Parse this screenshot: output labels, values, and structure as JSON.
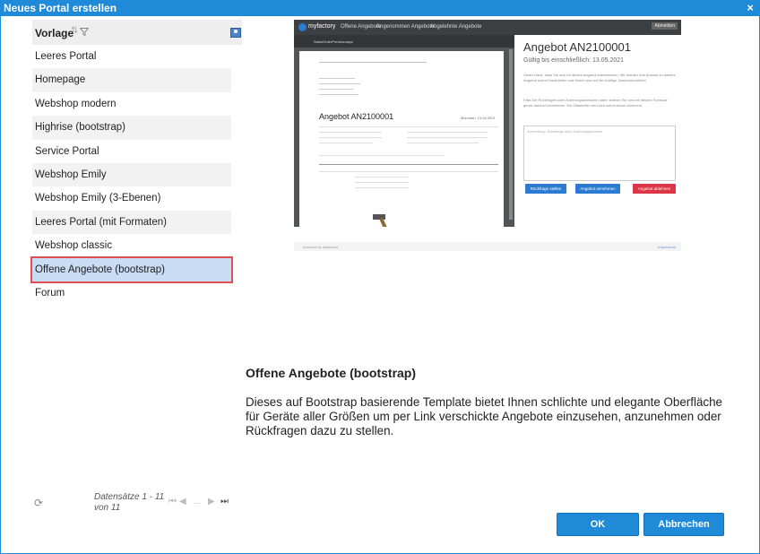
{
  "window": {
    "title": "Neues Portal erstellen",
    "close_glyph": "×"
  },
  "list": {
    "header_label": "Vorlage",
    "items": [
      "Leeres Portal",
      "Homepage",
      "Webshop modern",
      "Highrise (bootstrap)",
      "Service Portal",
      "Webshop Emily",
      "Webshop Emily (3-Ebenen)",
      "Leeres Portal (mit Formaten)",
      "Webshop classic",
      "Offene Angebote (bootstrap)",
      "Forum"
    ],
    "selected_index": 9
  },
  "pager": {
    "info_line1": "Datensätze 1 - 11",
    "info_line2": "von 11",
    "ellipsis": "..."
  },
  "preview": {
    "nav_brand": "myfactory",
    "nav_links": [
      "Offene Angebote",
      "Angenommen Angebote",
      "Abgelehnte Angebote"
    ],
    "nav_button": "Abmelden",
    "pdf_toolbar_file": "SalesOrderPreview.aspx",
    "pdf_heading": "Angebot AN2100001",
    "pdf_date": "München, 13.04.2021",
    "offer_title": "Angebot AN2100001",
    "valid_until": "Gültig bis einschließlich: 13.05.2021",
    "intro_text": "Vielen Dank, dass Sie sich für dieses Angebot interessieren. Wir werden Ihre Antwort zu diesem Angebot schnell bearbeiten und freuen uns auf die künftige Zusammenarbeit!",
    "info_text": "Falls Sie Rückfragen oder Änderungswünsche haben können Sie uns mit diesem Formular gerne darüber informieren. Ein Mitarbeiter wird sich sofort darum kümmern.",
    "textarea_placeholder": "Anmerkung, Rückfrage oder Änderungswunsch",
    "btn_question": "Rückfrage stellen",
    "btn_accept": "Angebot annehmen",
    "btn_decline": "Angebot ablehnen",
    "footer_left": "powered by  myfactory",
    "footer_right": "Impressum",
    "colors": {
      "nav": "#3d4043",
      "primary": "#2a7bd1",
      "danger": "#dc3545"
    }
  },
  "description": {
    "title": "Offene Angebote (bootstrap)",
    "text": "Dieses auf Bootstrap basierende Template bietet Ihnen schlichte und elegante Oberfläche für Geräte aller Größen um per Link verschickte Angebote einzusehen, anzunehmen oder Rückfragen dazu zu stellen."
  },
  "buttons": {
    "ok": "OK",
    "cancel": "Abbrechen"
  },
  "colors": {
    "accent": "#1e8ad8",
    "selection": "#c8dcf4",
    "highlight_border": "#e05050"
  }
}
